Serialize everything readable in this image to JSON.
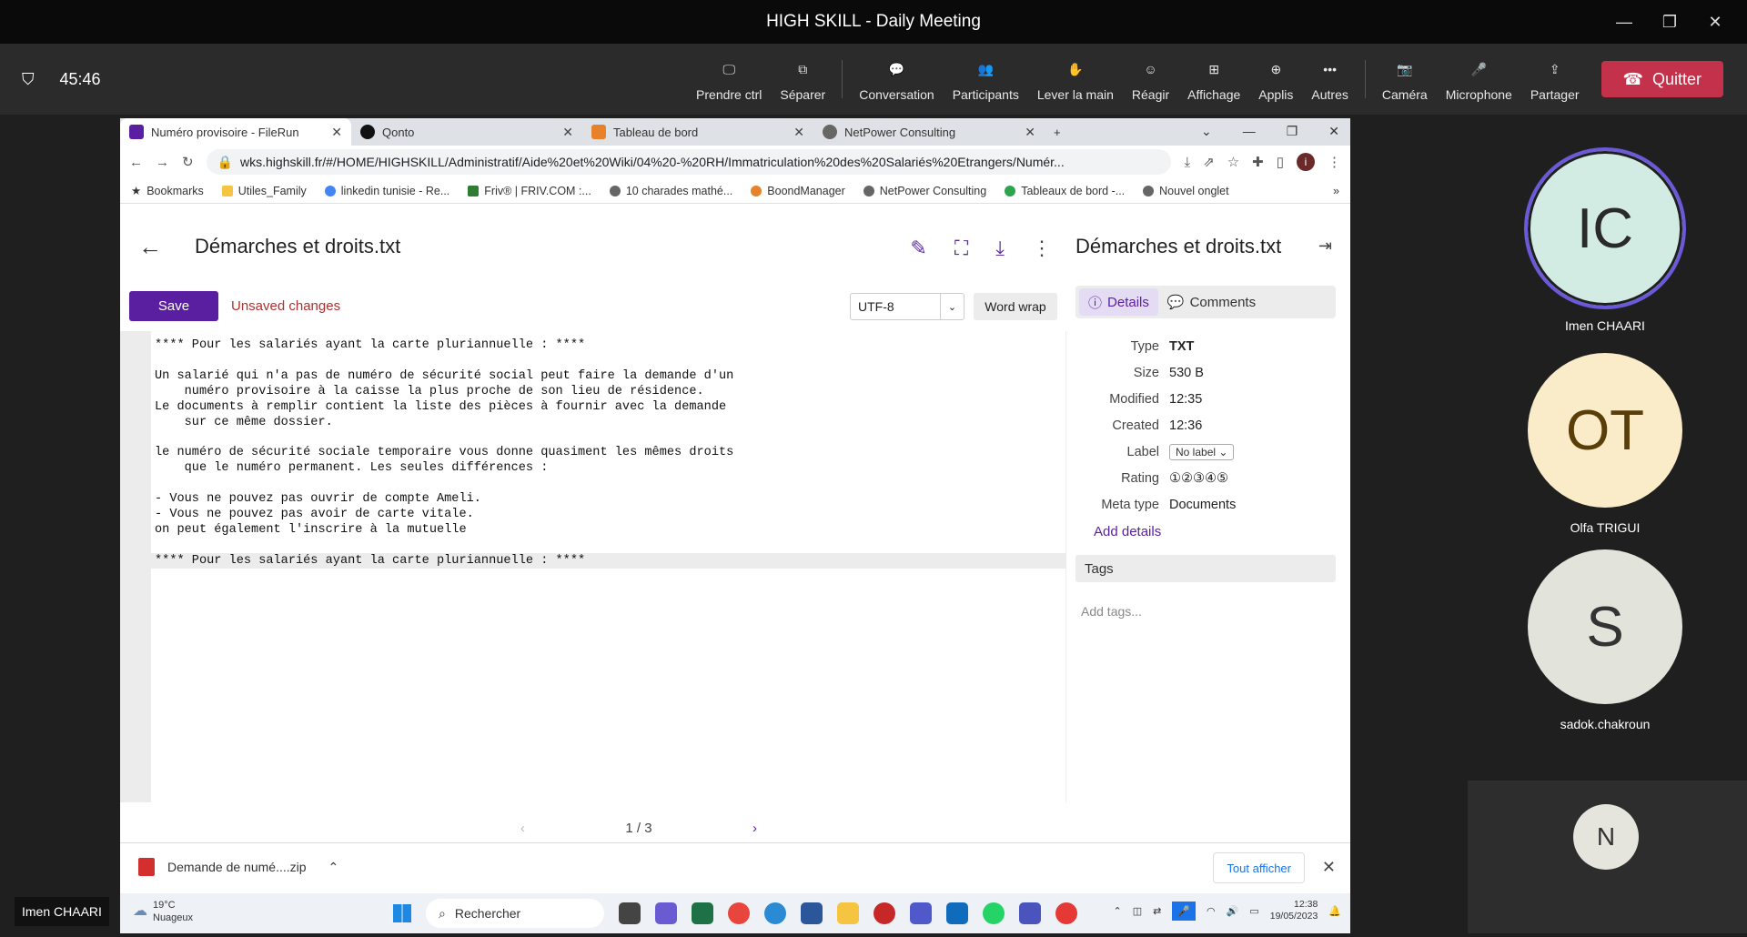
{
  "meeting": {
    "title": "HIGH SKILL - Daily Meeting",
    "timer": "45:46",
    "toolbar": [
      "Prendre ctrl",
      "Séparer",
      "Conversation",
      "Participants",
      "Lever la main",
      "Réagir",
      "Affichage",
      "Applis",
      "Autres",
      "Caméra",
      "Microphone",
      "Partager"
    ],
    "quit": "Quitter",
    "presenter": "Imen CHAARI",
    "participants": [
      {
        "initials": "IC",
        "name": "Imen CHAARI",
        "color": "#d2ece4"
      },
      {
        "initials": "OT",
        "name": "Olfa TRIGUI",
        "color": "#fbecc9"
      },
      {
        "initials": "S",
        "name": "sadok.chakroun",
        "color": "#e2e4dc"
      }
    ],
    "extra_initial": "N"
  },
  "browser": {
    "tabs": [
      "Numéro provisoire - FileRun",
      "Qonto",
      "Tableau de bord",
      "NetPower Consulting"
    ],
    "url": "wks.highskill.fr/#/HOME/HIGHSKILL/Administratif/Aide%20et%20Wiki/04%20-%20RH/Immatriculation%20des%20Salariés%20Etrangers/Numér...",
    "bookmarks": [
      "Bookmarks",
      "Utiles_Family",
      "linkedin tunisie - Re...",
      "Friv® | FRIV.COM :...",
      "10 charades mathé...",
      "BoondManager",
      "NetPower Consulting",
      "Tableaux de bord -...",
      "Nouvel onglet"
    ]
  },
  "editor": {
    "title": "Démarches et droits.txt",
    "save": "Save",
    "unsaved": "Unsaved changes",
    "encoding": "UTF-8",
    "wordwrap": "Word wrap",
    "text": "**** Pour les salariés ayant la carte pluriannuelle : ****\n\nUn salarié qui n'a pas de numéro de sécurité social peut faire la demande d'un\n    numéro provisoire à la caisse la plus proche de son lieu de résidence.\nLe documents à remplir contient la liste des pièces à fournir avec la demande\n    sur ce même dossier.\n\nle numéro de sécurité sociale temporaire vous donne quasiment les mêmes droits\n    que le numéro permanent. Les seules différences :\n\n- Vous ne pouvez pas ouvrir de compte Ameli.\n- Vous ne pouvez pas avoir de carte vitale.\non peut également l'inscrire à la mutuelle\n\n**** Pour les salariés ayant la carte pluriannuelle : ****",
    "pager": "1 / 3"
  },
  "details": {
    "title": "Démarches et droits.txt",
    "tab_details": "Details",
    "tab_comments": "Comments",
    "rows": [
      {
        "k": "Type",
        "v": "TXT"
      },
      {
        "k": "Size",
        "v": "530 B"
      },
      {
        "k": "Modified",
        "v": "12:35"
      },
      {
        "k": "Created",
        "v": "12:36"
      }
    ],
    "label_key": "Label",
    "label_value": "No label",
    "rating_key": "Rating",
    "rating_value": "①②③④⑤",
    "metatype_key": "Meta type",
    "metatype_value": "Documents",
    "add_details": "Add details",
    "tags": "Tags",
    "add_tags": "Add tags..."
  },
  "download": {
    "file": "Demande de numé....zip",
    "show_all": "Tout afficher"
  },
  "taskbar": {
    "temp": "19°C",
    "weather": "Nuageux",
    "search": "Rechercher",
    "time": "12:38",
    "date": "19/05/2023"
  }
}
